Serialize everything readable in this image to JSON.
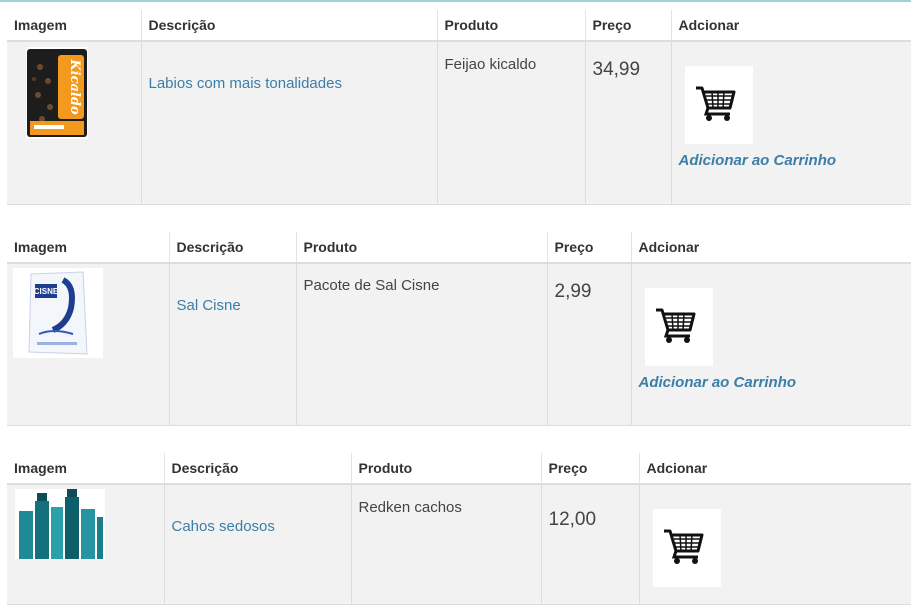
{
  "table_headers": {
    "image": "Imagem",
    "description": "Descrição",
    "product": "Produto",
    "price": "Preço",
    "add": "Adcionar"
  },
  "products": [
    {
      "description": "Labios com mais tonalidades",
      "product": "Feijao kicaldo",
      "price": "34,99",
      "add_label": "Adicionar ao Carrinho",
      "image_icon": "bean-package-image",
      "image_text": "Kicaldo"
    },
    {
      "description": "Sal Cisne",
      "product": "Pacote de Sal Cisne",
      "price": "2,99",
      "add_label": "Adicionar ao Carrinho",
      "image_icon": "salt-package-image",
      "image_text": "CISNE"
    },
    {
      "description": "Cahos sedosos",
      "product": "Redken cachos",
      "price": "12,00",
      "add_label": "",
      "image_icon": "hair-products-image",
      "image_text": ""
    }
  ],
  "cart_icon": "shopping-cart-icon",
  "colors": {
    "link": "#3b7ea8",
    "row_bg": "#f2f2f2",
    "header_bg": "#ffffff"
  }
}
